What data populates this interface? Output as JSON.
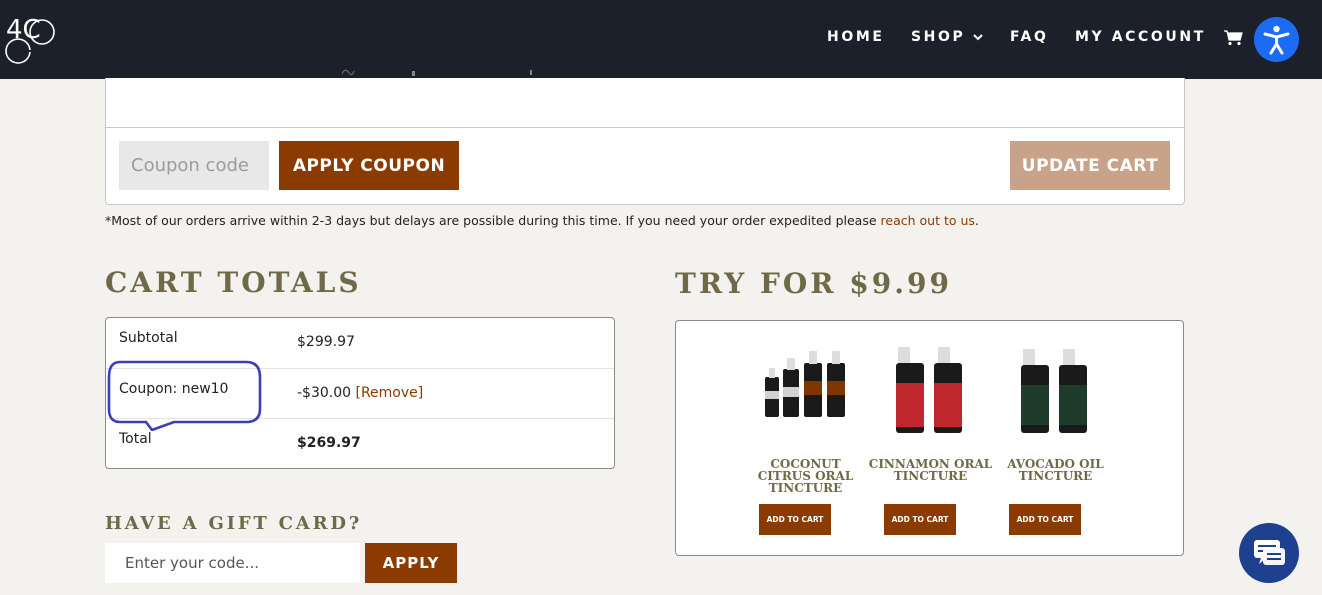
{
  "header": {
    "logo_text": "4C",
    "nav": [
      {
        "label": "HOME"
      },
      {
        "label": "SHOP"
      },
      {
        "label": "FAQ"
      },
      {
        "label": "MY ACCOUNT"
      }
    ]
  },
  "cart": {
    "coupon_placeholder": "Coupon code",
    "apply_coupon_label": "APPLY COUPON",
    "update_cart_label": "UPDATE CART",
    "notice_text": "*Most of our orders arrive within 2-3 days but delays are possible during this time. If you need your order expedited please ",
    "notice_link": "reach out to us",
    "notice_end": "."
  },
  "cart_totals": {
    "heading": "CART TOTALS",
    "rows": [
      {
        "label": "Subtotal",
        "value": "$299.97"
      },
      {
        "label": "Coupon: new10",
        "value": "-$30.00",
        "action": "[Remove]"
      },
      {
        "label": "Total",
        "value": "$269.97"
      }
    ]
  },
  "gift_card": {
    "heading": "HAVE A GIFT CARD?",
    "placeholder": "Enter your code...",
    "apply_label": "APPLY"
  },
  "try_offer": {
    "heading": "TRY FOR $9.99",
    "products": [
      {
        "name": "COCONUT CITRUS ORAL TINCTURE",
        "button": "ADD TO CART",
        "bottle_color": "#1a1a1a"
      },
      {
        "name": "CINNAMON ORAL TINCTURE",
        "button": "ADD TO CART",
        "bottle_color": "#c0262e"
      },
      {
        "name": "AVOCADO OIL TINCTURE",
        "button": "ADD TO CART",
        "bottle_color": "#1e3b2c"
      }
    ]
  },
  "colors": {
    "header_bg": "#1c202b",
    "accent_brown": "#8b3a00",
    "update_cart_bg": "#c8a389",
    "heading_olive": "#6e6a48",
    "a11y_blue": "#1b6cf2",
    "chat_blue": "#1f3f8f",
    "annotation_blue": "#3b3fb8"
  },
  "icons": [
    "logo-icon",
    "chevron-down-icon",
    "cart-icon",
    "accessibility-icon",
    "chat-icon"
  ]
}
